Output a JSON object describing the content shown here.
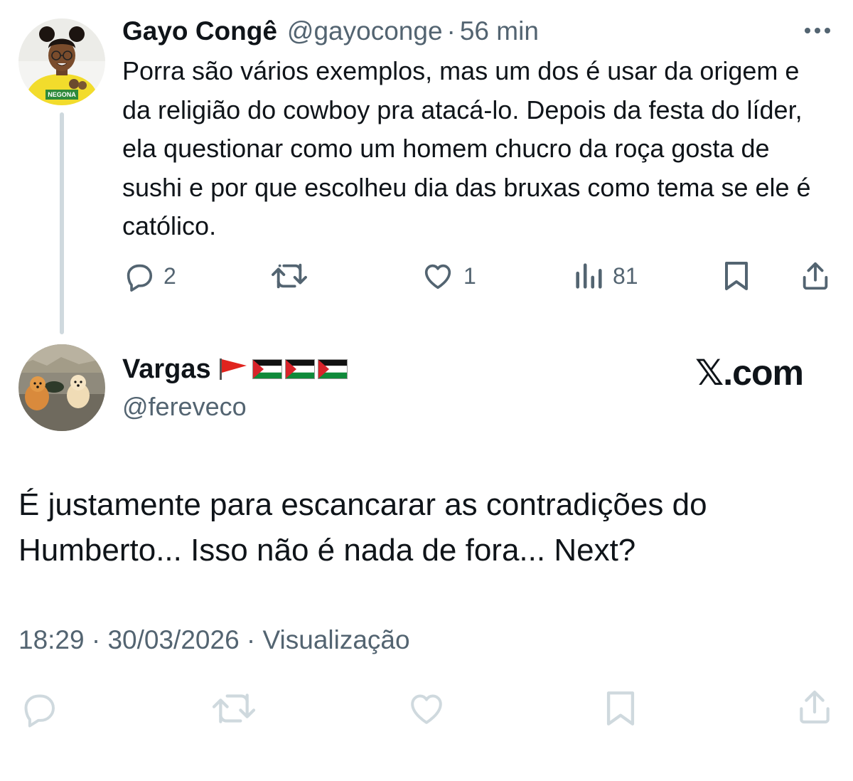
{
  "tweet1": {
    "author_name": "Gayo Congê",
    "author_handle": "@gayoconge",
    "separator": "·",
    "time": "56 min",
    "text": "Porra são vários exemplos, mas um dos é usar da origem e da religião do cowboy pra atacá-lo. Depois da festa do líder, ela questionar como um homem chucro da roça gosta de sushi e por que escolheu dia das bruxas como tema se ele é católico.",
    "reply_count": "2",
    "retweet_count": "",
    "like_count": "1",
    "view_count": "81",
    "icons": {
      "more": "more-icon",
      "reply": "reply-icon",
      "retweet": "retweet-icon",
      "like": "like-icon",
      "views": "views-icon",
      "bookmark": "bookmark-icon",
      "share": "share-icon"
    }
  },
  "tweet2": {
    "author_name": "Vargas",
    "author_flags": [
      "red-flag",
      "palestine-flag",
      "palestine-flag",
      "palestine-flag"
    ],
    "author_handle": "@fereveco",
    "brand": "𝕏.com",
    "text": "É justamente para escancarar as contradições do Humberto... Isso não é nada de fora... Next?",
    "timestamp": "18:29 · 30/03/2026 · Visualização"
  },
  "colors": {
    "text_primary": "#0f1419",
    "text_secondary": "#536471",
    "thread_line": "#cfd9de",
    "faded_icon": "#cfd9de",
    "avatar_yellow": "#f2dc2c"
  }
}
